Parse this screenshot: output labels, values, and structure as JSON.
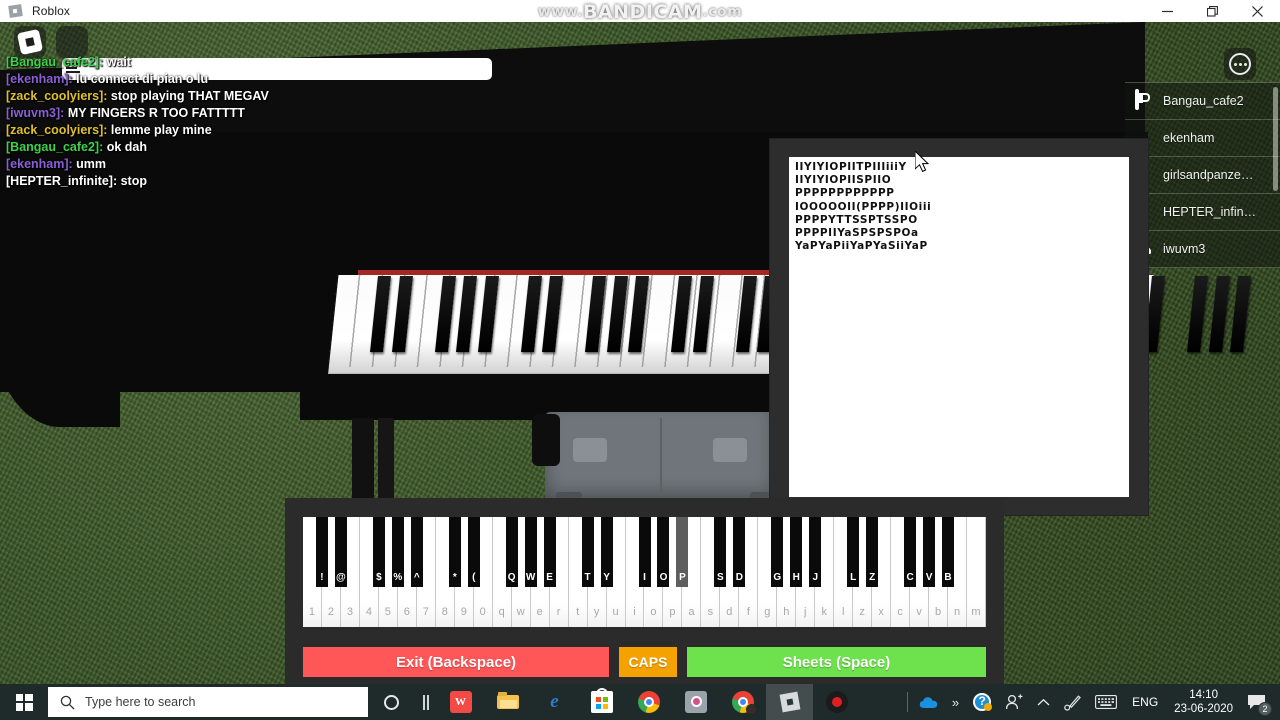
{
  "window": {
    "title": "Roblox",
    "icon": "roblox-app-icon",
    "minimize_label": "Minimize",
    "restore_label": "Restore",
    "close_label": "Close"
  },
  "watermark": {
    "prefix": "www.",
    "main": "BANDICAM",
    "suffix": ".com"
  },
  "roblox_topbar": {
    "logo_label": "Roblox menu",
    "chat_label": "Chat",
    "more_label": "More"
  },
  "chat": {
    "messages": [
      {
        "name": "[Bangau_cafe2]:",
        "color": "#3ad44b",
        "text": "wait"
      },
      {
        "name": "[ekenham]:",
        "color": "#8a5fd6",
        "text": "lu connect di pian o lu"
      },
      {
        "name": "[zack_coolyiers]:",
        "color": "#e0c02a",
        "text": "stop playing THAT MEGAV"
      },
      {
        "name": "[iwuvm3]:",
        "color": "#8a5fd6",
        "text": "MY FINGERS R TOO FATTTTT"
      },
      {
        "name": "[zack_coolyiers]:",
        "color": "#e0c02a",
        "text": "lemme play mine"
      },
      {
        "name": "[Bangau_cafe2]:",
        "color": "#3ad44b",
        "text": "ok dah"
      },
      {
        "name": "[ekenham]:",
        "color": "#8a5fd6",
        "text": "umm"
      },
      {
        "name": "[HEPTER_infinite]:",
        "color": "#ffffff",
        "text": "stop"
      }
    ]
  },
  "playerlist": {
    "players": [
      {
        "name": "Bangau_cafe2",
        "icon": "premium-icon"
      },
      {
        "name": "ekenham",
        "icon": "none"
      },
      {
        "name": "girlsandpanze…",
        "icon": "none"
      },
      {
        "name": "HEPTER_infin…",
        "icon": "none"
      },
      {
        "name": "iwuvm3",
        "icon": "friends-icon"
      }
    ]
  },
  "sheet_panel": {
    "lines": [
      "IIYIYIOPIITPIIIiiiY",
      "IIYIYIOPIISPIIO",
      "PPPPPPPPPPPP",
      "IOOOOOII(PPPP)IIOiii",
      "PPPPYTTSSPTSSPO",
      "PPPPIIYaSPSPSPOa",
      "YaPYaPiiYaPYaSiiYaP"
    ]
  },
  "piano_gui": {
    "white_keys": [
      "1",
      "2",
      "3",
      "4",
      "5",
      "6",
      "7",
      "8",
      "9",
      "0",
      "q",
      "w",
      "e",
      "r",
      "t",
      "y",
      "u",
      "i",
      "o",
      "p",
      "a",
      "s",
      "d",
      "f",
      "g",
      "h",
      "j",
      "k",
      "l",
      "z",
      "x",
      "c",
      "v",
      "b",
      "n",
      "m"
    ],
    "black_keys": [
      {
        "label": "!",
        "after": 0,
        "pressed": false
      },
      {
        "label": "@",
        "after": 1,
        "pressed": false
      },
      {
        "label": "$",
        "after": 3,
        "pressed": false
      },
      {
        "label": "%",
        "after": 4,
        "pressed": false
      },
      {
        "label": "^",
        "after": 5,
        "pressed": false
      },
      {
        "label": "*",
        "after": 7,
        "pressed": false
      },
      {
        "label": "(",
        "after": 8,
        "pressed": false
      },
      {
        "label": "Q",
        "after": 10,
        "pressed": false
      },
      {
        "label": "W",
        "after": 11,
        "pressed": false
      },
      {
        "label": "E",
        "after": 12,
        "pressed": false
      },
      {
        "label": "T",
        "after": 14,
        "pressed": false
      },
      {
        "label": "Y",
        "after": 15,
        "pressed": false
      },
      {
        "label": "I",
        "after": 17,
        "pressed": false
      },
      {
        "label": "O",
        "after": 18,
        "pressed": false
      },
      {
        "label": "P",
        "after": 19,
        "pressed": true
      },
      {
        "label": "S",
        "after": 21,
        "pressed": false
      },
      {
        "label": "D",
        "after": 22,
        "pressed": false
      },
      {
        "label": "G",
        "after": 24,
        "pressed": false
      },
      {
        "label": "H",
        "after": 25,
        "pressed": false
      },
      {
        "label": "J",
        "after": 26,
        "pressed": false
      },
      {
        "label": "L",
        "after": 28,
        "pressed": false
      },
      {
        "label": "Z",
        "after": 29,
        "pressed": false
      },
      {
        "label": "C",
        "after": 31,
        "pressed": false
      },
      {
        "label": "V",
        "after": 32,
        "pressed": false
      },
      {
        "label": "B",
        "after": 33,
        "pressed": false
      }
    ],
    "exit_label": "Exit (Backspace)",
    "caps_label": "CAPS",
    "sheets_label": "Sheets (Space)",
    "exit_color": "#ff5757",
    "caps_color": "#f5a200",
    "sheets_color": "#6ee24d"
  },
  "taskbar": {
    "start_label": "Start",
    "search_placeholder": "Type here to search",
    "items": [
      {
        "name": "cortana",
        "label": "Cortana"
      },
      {
        "name": "task-view",
        "label": "Task View"
      },
      {
        "name": "wps-office",
        "label": "WPS Office"
      },
      {
        "name": "file-explorer",
        "label": "File Explorer"
      },
      {
        "name": "edge",
        "label": "Microsoft Edge"
      },
      {
        "name": "microsoft-store",
        "label": "Microsoft Store"
      },
      {
        "name": "chrome",
        "label": "Google Chrome"
      },
      {
        "name": "camera",
        "label": "Camera"
      },
      {
        "name": "chrome-profile",
        "label": "Google Chrome"
      },
      {
        "name": "roblox",
        "label": "Roblox"
      },
      {
        "name": "bandicam",
        "label": "Bandicam"
      }
    ],
    "tray": {
      "onedrive_label": "OneDrive",
      "overflow_label": "Show hidden icons",
      "help_label": "Get Help",
      "people_label": "People",
      "chevron_label": "Show hidden icons",
      "pen_label": "Windows Ink Workspace",
      "keyboard_label": "Touch keyboard",
      "language": "ENG",
      "time": "14:10",
      "date": "23-06-2020",
      "notifications_label": "Action Center",
      "notifications_count": "2"
    }
  }
}
